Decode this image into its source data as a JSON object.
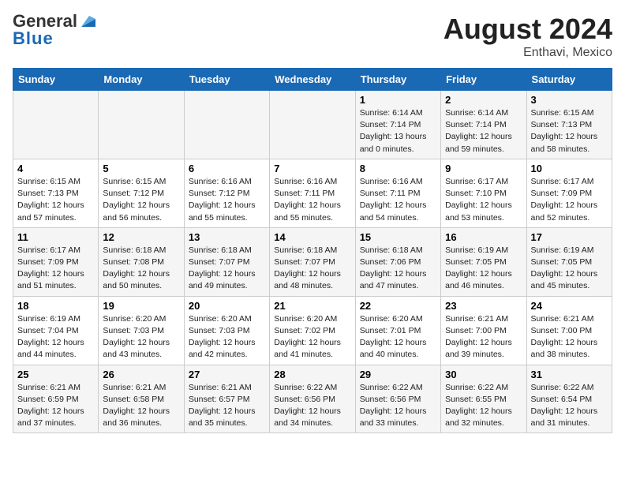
{
  "header": {
    "logo_general": "General",
    "logo_blue": "Blue",
    "month_year": "August 2024",
    "location": "Enthavi, Mexico"
  },
  "weekdays": [
    "Sunday",
    "Monday",
    "Tuesday",
    "Wednesday",
    "Thursday",
    "Friday",
    "Saturday"
  ],
  "weeks": [
    [
      {
        "day": "",
        "info": ""
      },
      {
        "day": "",
        "info": ""
      },
      {
        "day": "",
        "info": ""
      },
      {
        "day": "",
        "info": ""
      },
      {
        "day": "1",
        "info": "Sunrise: 6:14 AM\nSunset: 7:14 PM\nDaylight: 13 hours and 0 minutes."
      },
      {
        "day": "2",
        "info": "Sunrise: 6:14 AM\nSunset: 7:14 PM\nDaylight: 12 hours and 59 minutes."
      },
      {
        "day": "3",
        "info": "Sunrise: 6:15 AM\nSunset: 7:13 PM\nDaylight: 12 hours and 58 minutes."
      }
    ],
    [
      {
        "day": "4",
        "info": "Sunrise: 6:15 AM\nSunset: 7:13 PM\nDaylight: 12 hours and 57 minutes."
      },
      {
        "day": "5",
        "info": "Sunrise: 6:15 AM\nSunset: 7:12 PM\nDaylight: 12 hours and 56 minutes."
      },
      {
        "day": "6",
        "info": "Sunrise: 6:16 AM\nSunset: 7:12 PM\nDaylight: 12 hours and 55 minutes."
      },
      {
        "day": "7",
        "info": "Sunrise: 6:16 AM\nSunset: 7:11 PM\nDaylight: 12 hours and 55 minutes."
      },
      {
        "day": "8",
        "info": "Sunrise: 6:16 AM\nSunset: 7:11 PM\nDaylight: 12 hours and 54 minutes."
      },
      {
        "day": "9",
        "info": "Sunrise: 6:17 AM\nSunset: 7:10 PM\nDaylight: 12 hours and 53 minutes."
      },
      {
        "day": "10",
        "info": "Sunrise: 6:17 AM\nSunset: 7:09 PM\nDaylight: 12 hours and 52 minutes."
      }
    ],
    [
      {
        "day": "11",
        "info": "Sunrise: 6:17 AM\nSunset: 7:09 PM\nDaylight: 12 hours and 51 minutes."
      },
      {
        "day": "12",
        "info": "Sunrise: 6:18 AM\nSunset: 7:08 PM\nDaylight: 12 hours and 50 minutes."
      },
      {
        "day": "13",
        "info": "Sunrise: 6:18 AM\nSunset: 7:07 PM\nDaylight: 12 hours and 49 minutes."
      },
      {
        "day": "14",
        "info": "Sunrise: 6:18 AM\nSunset: 7:07 PM\nDaylight: 12 hours and 48 minutes."
      },
      {
        "day": "15",
        "info": "Sunrise: 6:18 AM\nSunset: 7:06 PM\nDaylight: 12 hours and 47 minutes."
      },
      {
        "day": "16",
        "info": "Sunrise: 6:19 AM\nSunset: 7:05 PM\nDaylight: 12 hours and 46 minutes."
      },
      {
        "day": "17",
        "info": "Sunrise: 6:19 AM\nSunset: 7:05 PM\nDaylight: 12 hours and 45 minutes."
      }
    ],
    [
      {
        "day": "18",
        "info": "Sunrise: 6:19 AM\nSunset: 7:04 PM\nDaylight: 12 hours and 44 minutes."
      },
      {
        "day": "19",
        "info": "Sunrise: 6:20 AM\nSunset: 7:03 PM\nDaylight: 12 hours and 43 minutes."
      },
      {
        "day": "20",
        "info": "Sunrise: 6:20 AM\nSunset: 7:03 PM\nDaylight: 12 hours and 42 minutes."
      },
      {
        "day": "21",
        "info": "Sunrise: 6:20 AM\nSunset: 7:02 PM\nDaylight: 12 hours and 41 minutes."
      },
      {
        "day": "22",
        "info": "Sunrise: 6:20 AM\nSunset: 7:01 PM\nDaylight: 12 hours and 40 minutes."
      },
      {
        "day": "23",
        "info": "Sunrise: 6:21 AM\nSunset: 7:00 PM\nDaylight: 12 hours and 39 minutes."
      },
      {
        "day": "24",
        "info": "Sunrise: 6:21 AM\nSunset: 7:00 PM\nDaylight: 12 hours and 38 minutes."
      }
    ],
    [
      {
        "day": "25",
        "info": "Sunrise: 6:21 AM\nSunset: 6:59 PM\nDaylight: 12 hours and 37 minutes."
      },
      {
        "day": "26",
        "info": "Sunrise: 6:21 AM\nSunset: 6:58 PM\nDaylight: 12 hours and 36 minutes."
      },
      {
        "day": "27",
        "info": "Sunrise: 6:21 AM\nSunset: 6:57 PM\nDaylight: 12 hours and 35 minutes."
      },
      {
        "day": "28",
        "info": "Sunrise: 6:22 AM\nSunset: 6:56 PM\nDaylight: 12 hours and 34 minutes."
      },
      {
        "day": "29",
        "info": "Sunrise: 6:22 AM\nSunset: 6:56 PM\nDaylight: 12 hours and 33 minutes."
      },
      {
        "day": "30",
        "info": "Sunrise: 6:22 AM\nSunset: 6:55 PM\nDaylight: 12 hours and 32 minutes."
      },
      {
        "day": "31",
        "info": "Sunrise: 6:22 AM\nSunset: 6:54 PM\nDaylight: 12 hours and 31 minutes."
      }
    ]
  ]
}
